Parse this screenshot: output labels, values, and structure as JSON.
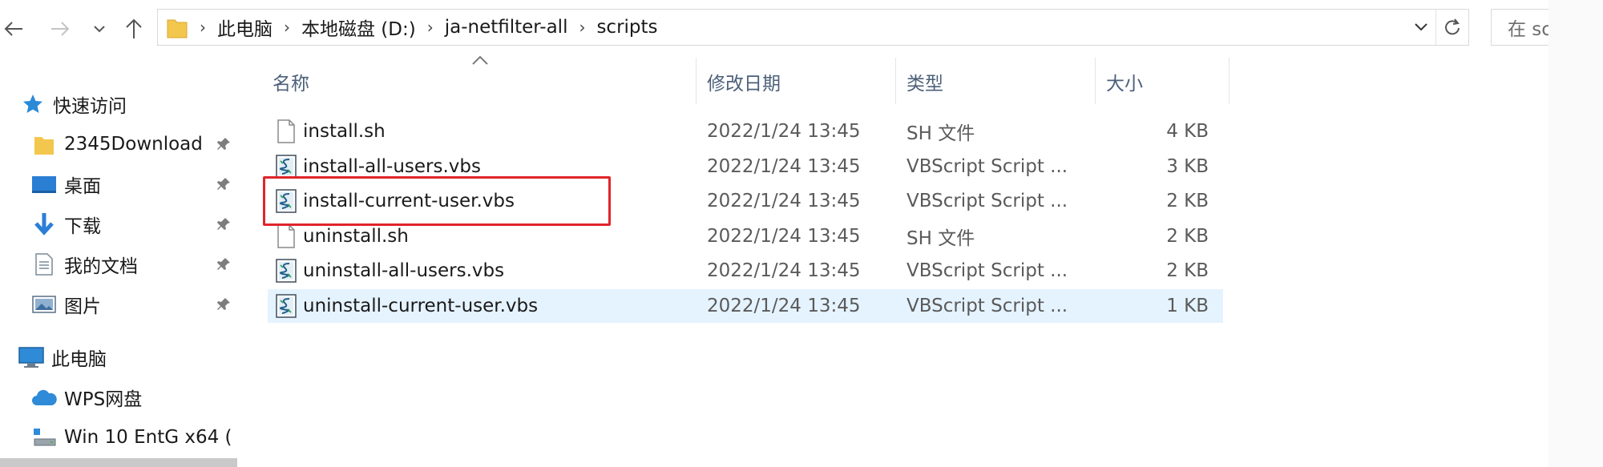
{
  "breadcrumb": [
    "此电脑",
    "本地磁盘 (D:)",
    "ja-netfilter-all",
    "scripts"
  ],
  "search": {
    "placeholder": "在 sc"
  },
  "nav": {
    "quick_access": "快速访问",
    "pinned": [
      {
        "label": "2345Download",
        "icon": "folder-icon"
      },
      {
        "label": "桌面",
        "icon": "desktop-icon"
      },
      {
        "label": "下载",
        "icon": "download-icon"
      },
      {
        "label": "我的文档",
        "icon": "documents-icon"
      },
      {
        "label": "图片",
        "icon": "pictures-icon"
      }
    ],
    "this_pc": "此电脑",
    "wps": "WPS网盘",
    "drive": "Win 10 EntG x64 ("
  },
  "columns": {
    "name": "名称",
    "date": "修改日期",
    "type": "类型",
    "size": "大小"
  },
  "files": [
    {
      "name": "install.sh",
      "date": "2022/1/24 13:45",
      "type": "SH 文件",
      "size": "4 KB",
      "icon": "sh-file-icon"
    },
    {
      "name": "install-all-users.vbs",
      "date": "2022/1/24 13:45",
      "type": "VBScript Script ...",
      "size": "3 KB",
      "icon": "vbs-file-icon"
    },
    {
      "name": "install-current-user.vbs",
      "date": "2022/1/24 13:45",
      "type": "VBScript Script ...",
      "size": "2 KB",
      "icon": "vbs-file-icon"
    },
    {
      "name": "uninstall.sh",
      "date": "2022/1/24 13:45",
      "type": "SH 文件",
      "size": "2 KB",
      "icon": "sh-file-icon"
    },
    {
      "name": "uninstall-all-users.vbs",
      "date": "2022/1/24 13:45",
      "type": "VBScript Script ...",
      "size": "2 KB",
      "icon": "vbs-file-icon"
    },
    {
      "name": "uninstall-current-user.vbs",
      "date": "2022/1/24 13:45",
      "type": "VBScript Script ...",
      "size": "1 KB",
      "icon": "vbs-file-icon"
    }
  ],
  "selected_index": 5,
  "highlighted_index": 2,
  "colors": {
    "highlight": "#e0252b",
    "selection": "#e5f3ff",
    "header_text": "#4c607a",
    "folder": "#f3c64d"
  }
}
